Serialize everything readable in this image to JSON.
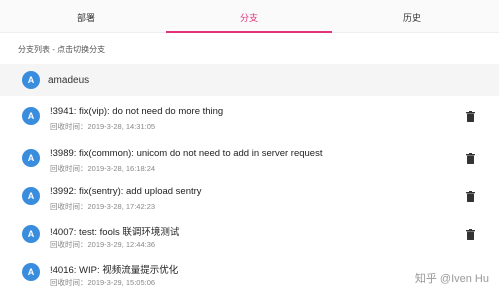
{
  "tabs": [
    {
      "label": "部署"
    },
    {
      "label": "分支"
    },
    {
      "label": "历史"
    }
  ],
  "branch_hint": "分支列表 - 点击切换分支",
  "author": {
    "avatar": "A",
    "name": "amadeus"
  },
  "commits": [
    {
      "avatar": "A",
      "title": "!3941: fix(vip): do not need do more thing",
      "time": "回收时间：2019-3-28, 14:31:05"
    },
    {
      "avatar": "A",
      "title": "!3989: fix(common): unicom do not need to add in server request",
      "time": "回收时间：2019-3-28, 16:18:24"
    },
    {
      "avatar": "A",
      "title": "!3992: fix(sentry): add upload sentry",
      "time": "回收时间：2019-3-28, 17:42:23"
    },
    {
      "avatar": "A",
      "title": "!4007: test: fools 联调环境测试",
      "time": "回收时间：2019-3-29, 12:44:36"
    },
    {
      "avatar": "A",
      "title": "!4016: WIP: 视频流量提示优化",
      "time": "回收时间：2019-3-29, 15:05:06"
    }
  ],
  "watermark": "知乎 @Iven Hu",
  "colors": {
    "accent": "#e0337a",
    "avatar": "#3a8ddc"
  },
  "icons": {
    "delete": "trash-icon"
  }
}
